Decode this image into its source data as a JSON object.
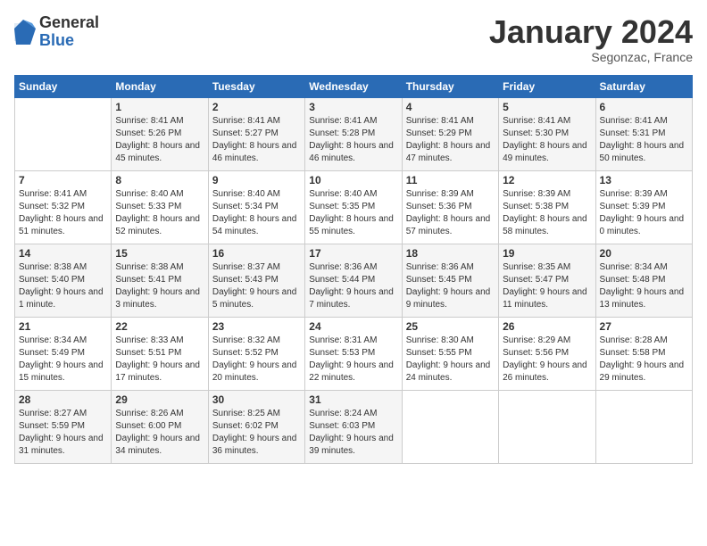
{
  "logo": {
    "general": "General",
    "blue": "Blue"
  },
  "header": {
    "month": "January 2024",
    "location": "Segonzac, France"
  },
  "weekdays": [
    "Sunday",
    "Monday",
    "Tuesday",
    "Wednesday",
    "Thursday",
    "Friday",
    "Saturday"
  ],
  "weeks": [
    [
      {
        "day": "",
        "sunrise": "",
        "sunset": "",
        "daylight": ""
      },
      {
        "day": "1",
        "sunrise": "Sunrise: 8:41 AM",
        "sunset": "Sunset: 5:26 PM",
        "daylight": "Daylight: 8 hours and 45 minutes."
      },
      {
        "day": "2",
        "sunrise": "Sunrise: 8:41 AM",
        "sunset": "Sunset: 5:27 PM",
        "daylight": "Daylight: 8 hours and 46 minutes."
      },
      {
        "day": "3",
        "sunrise": "Sunrise: 8:41 AM",
        "sunset": "Sunset: 5:28 PM",
        "daylight": "Daylight: 8 hours and 46 minutes."
      },
      {
        "day": "4",
        "sunrise": "Sunrise: 8:41 AM",
        "sunset": "Sunset: 5:29 PM",
        "daylight": "Daylight: 8 hours and 47 minutes."
      },
      {
        "day": "5",
        "sunrise": "Sunrise: 8:41 AM",
        "sunset": "Sunset: 5:30 PM",
        "daylight": "Daylight: 8 hours and 49 minutes."
      },
      {
        "day": "6",
        "sunrise": "Sunrise: 8:41 AM",
        "sunset": "Sunset: 5:31 PM",
        "daylight": "Daylight: 8 hours and 50 minutes."
      }
    ],
    [
      {
        "day": "7",
        "sunrise": "Sunrise: 8:41 AM",
        "sunset": "Sunset: 5:32 PM",
        "daylight": "Daylight: 8 hours and 51 minutes."
      },
      {
        "day": "8",
        "sunrise": "Sunrise: 8:40 AM",
        "sunset": "Sunset: 5:33 PM",
        "daylight": "Daylight: 8 hours and 52 minutes."
      },
      {
        "day": "9",
        "sunrise": "Sunrise: 8:40 AM",
        "sunset": "Sunset: 5:34 PM",
        "daylight": "Daylight: 8 hours and 54 minutes."
      },
      {
        "day": "10",
        "sunrise": "Sunrise: 8:40 AM",
        "sunset": "Sunset: 5:35 PM",
        "daylight": "Daylight: 8 hours and 55 minutes."
      },
      {
        "day": "11",
        "sunrise": "Sunrise: 8:39 AM",
        "sunset": "Sunset: 5:36 PM",
        "daylight": "Daylight: 8 hours and 57 minutes."
      },
      {
        "day": "12",
        "sunrise": "Sunrise: 8:39 AM",
        "sunset": "Sunset: 5:38 PM",
        "daylight": "Daylight: 8 hours and 58 minutes."
      },
      {
        "day": "13",
        "sunrise": "Sunrise: 8:39 AM",
        "sunset": "Sunset: 5:39 PM",
        "daylight": "Daylight: 9 hours and 0 minutes."
      }
    ],
    [
      {
        "day": "14",
        "sunrise": "Sunrise: 8:38 AM",
        "sunset": "Sunset: 5:40 PM",
        "daylight": "Daylight: 9 hours and 1 minute."
      },
      {
        "day": "15",
        "sunrise": "Sunrise: 8:38 AM",
        "sunset": "Sunset: 5:41 PM",
        "daylight": "Daylight: 9 hours and 3 minutes."
      },
      {
        "day": "16",
        "sunrise": "Sunrise: 8:37 AM",
        "sunset": "Sunset: 5:43 PM",
        "daylight": "Daylight: 9 hours and 5 minutes."
      },
      {
        "day": "17",
        "sunrise": "Sunrise: 8:36 AM",
        "sunset": "Sunset: 5:44 PM",
        "daylight": "Daylight: 9 hours and 7 minutes."
      },
      {
        "day": "18",
        "sunrise": "Sunrise: 8:36 AM",
        "sunset": "Sunset: 5:45 PM",
        "daylight": "Daylight: 9 hours and 9 minutes."
      },
      {
        "day": "19",
        "sunrise": "Sunrise: 8:35 AM",
        "sunset": "Sunset: 5:47 PM",
        "daylight": "Daylight: 9 hours and 11 minutes."
      },
      {
        "day": "20",
        "sunrise": "Sunrise: 8:34 AM",
        "sunset": "Sunset: 5:48 PM",
        "daylight": "Daylight: 9 hours and 13 minutes."
      }
    ],
    [
      {
        "day": "21",
        "sunrise": "Sunrise: 8:34 AM",
        "sunset": "Sunset: 5:49 PM",
        "daylight": "Daylight: 9 hours and 15 minutes."
      },
      {
        "day": "22",
        "sunrise": "Sunrise: 8:33 AM",
        "sunset": "Sunset: 5:51 PM",
        "daylight": "Daylight: 9 hours and 17 minutes."
      },
      {
        "day": "23",
        "sunrise": "Sunrise: 8:32 AM",
        "sunset": "Sunset: 5:52 PM",
        "daylight": "Daylight: 9 hours and 20 minutes."
      },
      {
        "day": "24",
        "sunrise": "Sunrise: 8:31 AM",
        "sunset": "Sunset: 5:53 PM",
        "daylight": "Daylight: 9 hours and 22 minutes."
      },
      {
        "day": "25",
        "sunrise": "Sunrise: 8:30 AM",
        "sunset": "Sunset: 5:55 PM",
        "daylight": "Daylight: 9 hours and 24 minutes."
      },
      {
        "day": "26",
        "sunrise": "Sunrise: 8:29 AM",
        "sunset": "Sunset: 5:56 PM",
        "daylight": "Daylight: 9 hours and 26 minutes."
      },
      {
        "day": "27",
        "sunrise": "Sunrise: 8:28 AM",
        "sunset": "Sunset: 5:58 PM",
        "daylight": "Daylight: 9 hours and 29 minutes."
      }
    ],
    [
      {
        "day": "28",
        "sunrise": "Sunrise: 8:27 AM",
        "sunset": "Sunset: 5:59 PM",
        "daylight": "Daylight: 9 hours and 31 minutes."
      },
      {
        "day": "29",
        "sunrise": "Sunrise: 8:26 AM",
        "sunset": "Sunset: 6:00 PM",
        "daylight": "Daylight: 9 hours and 34 minutes."
      },
      {
        "day": "30",
        "sunrise": "Sunrise: 8:25 AM",
        "sunset": "Sunset: 6:02 PM",
        "daylight": "Daylight: 9 hours and 36 minutes."
      },
      {
        "day": "31",
        "sunrise": "Sunrise: 8:24 AM",
        "sunset": "Sunset: 6:03 PM",
        "daylight": "Daylight: 9 hours and 39 minutes."
      },
      {
        "day": "",
        "sunrise": "",
        "sunset": "",
        "daylight": ""
      },
      {
        "day": "",
        "sunrise": "",
        "sunset": "",
        "daylight": ""
      },
      {
        "day": "",
        "sunrise": "",
        "sunset": "",
        "daylight": ""
      }
    ]
  ]
}
